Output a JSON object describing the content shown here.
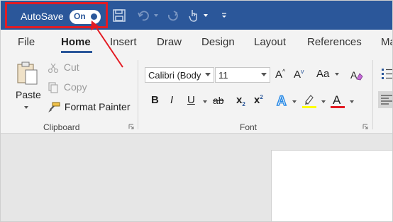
{
  "titlebar": {
    "autosave_label": "AutoSave",
    "toggle_state": "On"
  },
  "tabs": [
    {
      "label": "File"
    },
    {
      "label": "Home"
    },
    {
      "label": "Insert"
    },
    {
      "label": "Draw"
    },
    {
      "label": "Design"
    },
    {
      "label": "Layout"
    },
    {
      "label": "References"
    },
    {
      "label": "Ma"
    }
  ],
  "clipboard": {
    "paste_label": "Paste",
    "cut_label": "Cut",
    "copy_label": "Copy",
    "format_painter_label": "Format Painter",
    "group_label": "Clipboard"
  },
  "font": {
    "font_name": "Calibri (Body",
    "font_size": "11",
    "change_case_label": "Aa",
    "group_label": "Font"
  },
  "colors": {
    "title_bar": "#2b579a",
    "highlight_box": "#e31b23",
    "highlighter_yellow": "#ffff00",
    "font_color_red": "#e31b23"
  }
}
